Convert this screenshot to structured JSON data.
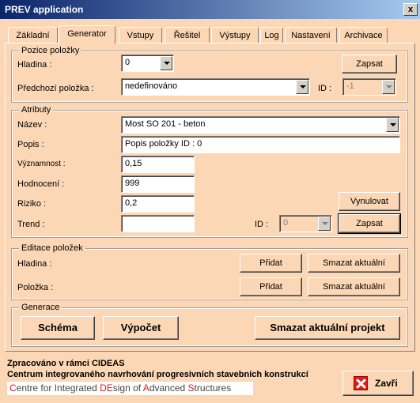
{
  "window": {
    "title": "PREV application",
    "close_glyph": "x"
  },
  "tabs": [
    {
      "label": "Základní"
    },
    {
      "label": "Generator"
    },
    {
      "label": "Vstupy"
    },
    {
      "label": "Řešitel"
    },
    {
      "label": "Výstupy"
    },
    {
      "label": "Log"
    },
    {
      "label": "Nastavení"
    },
    {
      "label": "Archivace"
    }
  ],
  "pozice": {
    "title": "Pozice položky",
    "hladina_label": "Hladina :",
    "hladina_value": "0",
    "predchozi_label": "Předchozí položka :",
    "predchozi_value": "nedefinováno",
    "id_label": "ID :",
    "id_value": "-1",
    "zapsat_label": "Zapsat"
  },
  "atributy": {
    "title": "Atributy",
    "nazev_label": "Název :",
    "nazev_value": "Most SO 201 - beton",
    "popis_label": "Popis :",
    "popis_value": "Popis položky ID : 0",
    "vyznamnost_label": "Významnost :",
    "vyznamnost_value": "0,15",
    "hodnoceni_label": "Hodnocení :",
    "hodnoceni_value": "999",
    "riziko_label": "Riziko :",
    "riziko_value": "0,2",
    "trend_label": "Trend :",
    "trend_value": "",
    "id_label": "ID :",
    "id_value": "0",
    "vynulovat_label": "Vynulovat",
    "zapsat_label": "Zapsat"
  },
  "editace": {
    "title": "Editace položek",
    "hladina_label": "Hladina :",
    "polozka_label": "Položka :",
    "pridat_label": "Přidat",
    "smazat_label": "Smazat aktuální"
  },
  "generace": {
    "title": "Generace",
    "schema_label": "Schéma",
    "vypocet_label": "Výpočet",
    "smazat_projekt_label": "Smazat aktuální projekt"
  },
  "footer": {
    "line1": "Zpracováno v rámci CIDEAS",
    "line2": "Centrum integrovaného navrhování progresivních stavebních konstrukcí",
    "logo": {
      "parts": [
        "C",
        "entre for ",
        "I",
        "ntegrated ",
        "DE",
        "sign of ",
        "A",
        "dvanced ",
        "S",
        "tructures"
      ]
    },
    "zavri_label": "Zavři"
  },
  "colors": {
    "background": "#fcd7b5",
    "titlebar": "#0a246a",
    "close_icon": "#e21b1b"
  }
}
